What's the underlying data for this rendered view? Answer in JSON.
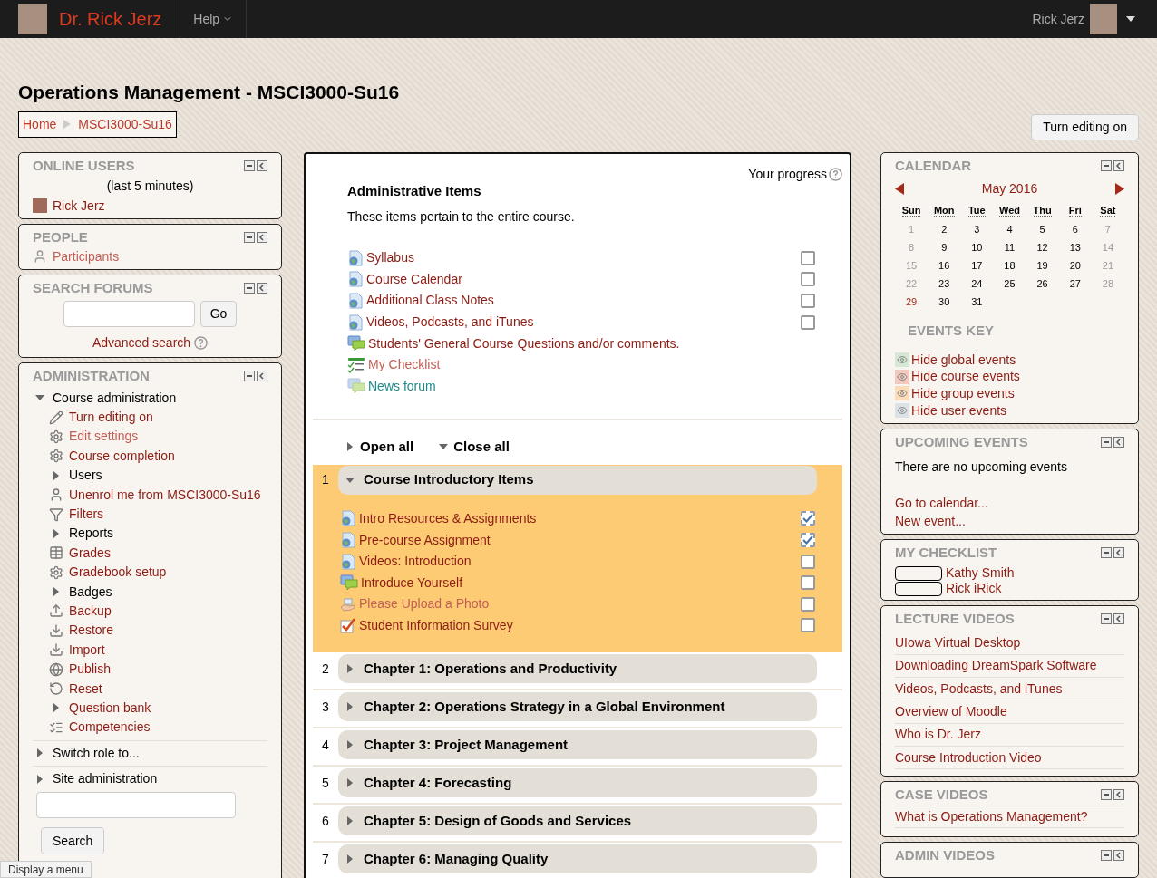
{
  "navbar": {
    "site_name": "Dr. Rick Jerz",
    "help_menu": "Help",
    "user_name": "Rick Jerz"
  },
  "page_title": "Operations Management - MSCI3000-Su16",
  "breadcrumb": [
    "Home",
    "MSCI3000-Su16"
  ],
  "edit_button": "Turn editing on",
  "online_users": {
    "title": "ONLINE USERS",
    "subtitle": "(last 5 minutes)",
    "users": [
      "Rick Jerz"
    ]
  },
  "people": {
    "title": "PEOPLE",
    "items": [
      "Participants"
    ]
  },
  "search_forums": {
    "title": "SEARCH FORUMS",
    "button": "Go",
    "advanced": "Advanced search"
  },
  "administration": {
    "title": "ADMINISTRATION",
    "search_button": "Search",
    "tree": [
      {
        "label": "Course administration",
        "kind": "branch",
        "is_link": false,
        "visited": false,
        "expanded": true,
        "children": [
          {
            "label": "Turn editing on",
            "kind": "pencil",
            "is_link": true,
            "visited": false
          },
          {
            "label": "Edit settings",
            "kind": "gear",
            "is_link": true,
            "visited": true
          },
          {
            "label": "Course completion",
            "kind": "gear",
            "is_link": true,
            "visited": false
          },
          {
            "label": "Users",
            "kind": "branch",
            "is_link": false,
            "visited": false,
            "expanded": false
          },
          {
            "label": "Unenrol me from MSCI3000-Su16",
            "kind": "person",
            "is_link": true,
            "visited": false
          },
          {
            "label": "Filters",
            "kind": "filter",
            "is_link": true,
            "visited": false
          },
          {
            "label": "Reports",
            "kind": "branch",
            "is_link": false,
            "visited": false,
            "expanded": false
          },
          {
            "label": "Grades",
            "kind": "grid",
            "is_link": true,
            "visited": false
          },
          {
            "label": "Gradebook setup",
            "kind": "gear",
            "is_link": true,
            "visited": false
          },
          {
            "label": "Badges",
            "kind": "branch",
            "is_link": false,
            "visited": false,
            "expanded": false
          },
          {
            "label": "Backup",
            "kind": "upload",
            "is_link": true,
            "visited": false
          },
          {
            "label": "Restore",
            "kind": "download",
            "is_link": true,
            "visited": false
          },
          {
            "label": "Import",
            "kind": "download",
            "is_link": true,
            "visited": false
          },
          {
            "label": "Publish",
            "kind": "globe",
            "is_link": true,
            "visited": false
          },
          {
            "label": "Reset",
            "kind": "reset",
            "is_link": true,
            "visited": false
          },
          {
            "label": "Question bank",
            "kind": "branch",
            "is_link": true,
            "visited": false,
            "expanded": false
          },
          {
            "label": "Competencies",
            "kind": "competency",
            "is_link": true,
            "visited": false
          }
        ]
      },
      {
        "label": "Switch role to...",
        "kind": "branch",
        "is_link": false,
        "visited": false,
        "expanded": false
      },
      {
        "label": "Site administration",
        "kind": "branch",
        "is_link": false,
        "visited": false,
        "expanded": false
      }
    ]
  },
  "progress_label": "Your progress",
  "general_section": {
    "title": "Administrative Items",
    "summary": "These items pertain to the entire course.",
    "activities": [
      {
        "name": "Syllabus",
        "kind": "page",
        "visited": false,
        "auto": false,
        "checked": false
      },
      {
        "name": "Course Calendar",
        "kind": "page",
        "visited": false,
        "auto": false,
        "checked": false
      },
      {
        "name": "Additional Class Notes",
        "kind": "page",
        "visited": false,
        "auto": false,
        "checked": false
      },
      {
        "name": "Videos, Podcasts, and iTunes",
        "kind": "page",
        "visited": false,
        "auto": false,
        "checked": false
      },
      {
        "name": "Students' General Course Questions and/or comments.",
        "kind": "forum",
        "visited": false
      },
      {
        "name": "My Checklist",
        "kind": "checklist",
        "visited": true
      },
      {
        "name": "News forum",
        "kind": "newsforum",
        "visited": false
      }
    ]
  },
  "open_all": "Open all",
  "close_all": "Close all",
  "sections": [
    {
      "number": "1",
      "title": "Course Introductory Items",
      "expanded": true,
      "highlighted": true,
      "activities": [
        {
          "name": "Intro Resources & Assignments",
          "kind": "page",
          "visited": false,
          "auto": true,
          "checked": true
        },
        {
          "name": "Pre-course Assignment",
          "kind": "page",
          "visited": false,
          "auto": true,
          "checked": true
        },
        {
          "name": "Videos: Introduction",
          "kind": "page",
          "visited": false,
          "auto": false,
          "checked": false
        },
        {
          "name": "Introduce Yourself",
          "kind": "forum",
          "visited": false,
          "auto": false,
          "checked": false
        },
        {
          "name": "Please Upload a Photo",
          "kind": "upload",
          "visited": true,
          "auto": false,
          "checked": false
        },
        {
          "name": "Student Information Survey",
          "kind": "survey",
          "visited": false,
          "auto": false,
          "checked": false
        }
      ]
    },
    {
      "number": "2",
      "title": "Chapter 1: Operations and Productivity",
      "expanded": false,
      "highlighted": false
    },
    {
      "number": "3",
      "title": "Chapter 2: Operations Strategy in a Global Environment",
      "expanded": false,
      "highlighted": false
    },
    {
      "number": "4",
      "title": "Chapter 3: Project Management",
      "expanded": false,
      "highlighted": false
    },
    {
      "number": "5",
      "title": "Chapter 4: Forecasting",
      "expanded": false,
      "highlighted": false
    },
    {
      "number": "6",
      "title": "Chapter 5: Design of Goods and Services",
      "expanded": false,
      "highlighted": false
    },
    {
      "number": "7",
      "title": "Chapter 6: Managing Quality",
      "expanded": false,
      "highlighted": false
    }
  ],
  "calendar": {
    "title": "CALENDAR",
    "month": "May 2016",
    "weekdays": [
      "Sun",
      "Mon",
      "Tue",
      "Wed",
      "Thu",
      "Fri",
      "Sat"
    ],
    "weeks": [
      [
        {
          "d": "1",
          "kind": "weekend"
        },
        {
          "d": "2",
          "kind": "day"
        },
        {
          "d": "3",
          "kind": "day"
        },
        {
          "d": "4",
          "kind": "day"
        },
        {
          "d": "5",
          "kind": "day"
        },
        {
          "d": "6",
          "kind": "day"
        },
        {
          "d": "7",
          "kind": "weekend"
        }
      ],
      [
        {
          "d": "8",
          "kind": "weekend"
        },
        {
          "d": "9",
          "kind": "day"
        },
        {
          "d": "10",
          "kind": "day"
        },
        {
          "d": "11",
          "kind": "day"
        },
        {
          "d": "12",
          "kind": "day"
        },
        {
          "d": "13",
          "kind": "day"
        },
        {
          "d": "14",
          "kind": "weekend"
        }
      ],
      [
        {
          "d": "15",
          "kind": "weekend"
        },
        {
          "d": "16",
          "kind": "day"
        },
        {
          "d": "17",
          "kind": "day"
        },
        {
          "d": "18",
          "kind": "day"
        },
        {
          "d": "19",
          "kind": "day"
        },
        {
          "d": "20",
          "kind": "day"
        },
        {
          "d": "21",
          "kind": "weekend"
        }
      ],
      [
        {
          "d": "22",
          "kind": "weekend"
        },
        {
          "d": "23",
          "kind": "day"
        },
        {
          "d": "24",
          "kind": "day"
        },
        {
          "d": "25",
          "kind": "day"
        },
        {
          "d": "26",
          "kind": "day"
        },
        {
          "d": "27",
          "kind": "day"
        },
        {
          "d": "28",
          "kind": "weekend"
        }
      ],
      [
        {
          "d": "29",
          "kind": "today"
        },
        {
          "d": "30",
          "kind": "day"
        },
        {
          "d": "31",
          "kind": "day"
        }
      ]
    ],
    "events_key_title": "EVENTS KEY",
    "events_key": [
      {
        "label": "Hide global events",
        "color": "#d6e8d4"
      },
      {
        "label": "Hide course events",
        "color": "#f2c9bd"
      },
      {
        "label": "Hide group events",
        "color": "#fbdcb8"
      },
      {
        "label": "Hide user events",
        "color": "#dce3e6"
      }
    ]
  },
  "upcoming_events": {
    "title": "UPCOMING EVENTS",
    "message": "There are no upcoming events",
    "links": [
      "Go to calendar...",
      "New event..."
    ]
  },
  "my_checklist": {
    "title": "MY CHECKLIST",
    "items": [
      {
        "name": "Kathy Smith",
        "level": 0
      },
      {
        "name": "Rick iRick",
        "level": 0
      }
    ]
  },
  "lecture_videos": {
    "title": "LECTURE VIDEOS",
    "links": [
      "UIowa Virtual Desktop",
      "Downloading DreamSpark Software",
      "Videos, Podcasts, and iTunes",
      "Overview of Moodle",
      "Who is Dr. Jerz",
      "Course Introduction Video"
    ]
  },
  "case_videos": {
    "title": "CASE VIDEOS",
    "links": [
      "What is Operations Management?"
    ]
  },
  "admin_videos": {
    "title": "ADMIN VIDEOS"
  },
  "status_tooltip": "Display a menu"
}
